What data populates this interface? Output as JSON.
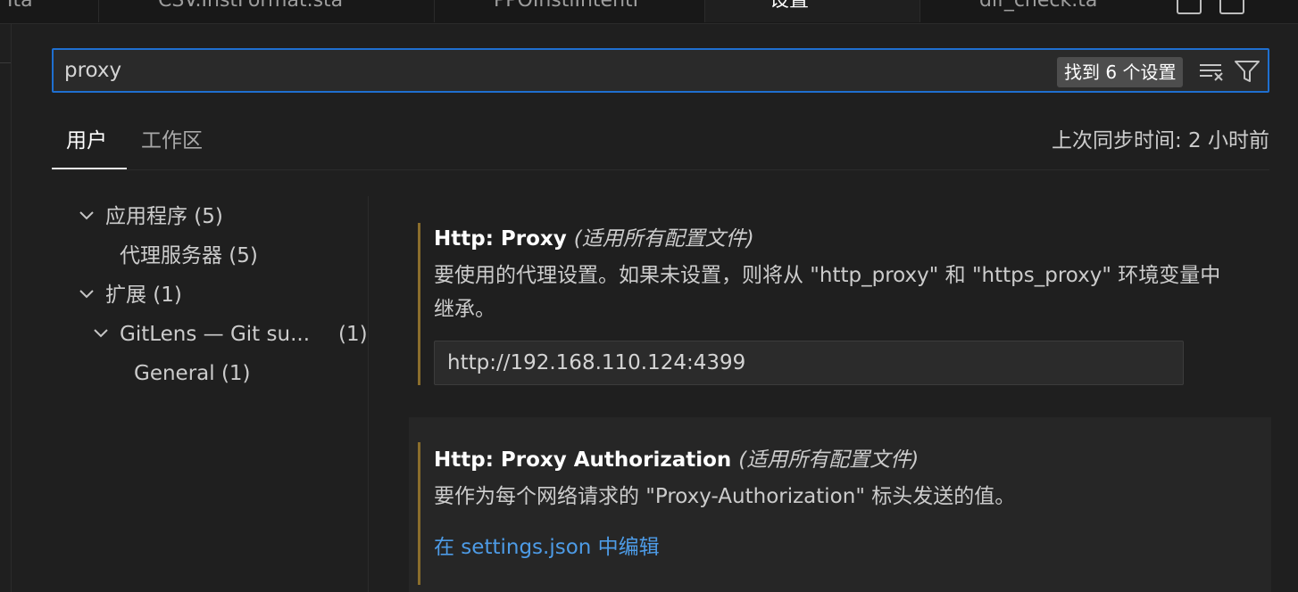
{
  "tabs": [
    {
      "label": "Ita"
    },
    {
      "label": "CSV.InstFormat.sta"
    },
    {
      "label": "PPOInstiIntentI"
    },
    {
      "label": "设置",
      "active": true
    },
    {
      "label": "dif_check.ta"
    }
  ],
  "search": {
    "value": "proxy",
    "placeholder": "",
    "found_label": "找到 6 个设置"
  },
  "scope_tabs": [
    {
      "label": "用户",
      "active": true
    },
    {
      "label": "工作区",
      "active": false
    }
  ],
  "sync_status": "上次同步时间: 2 小时前",
  "toc": [
    {
      "label": "应用程序 (5)",
      "expanded": true
    },
    {
      "label": "代理服务器 (5)"
    },
    {
      "label": "扩展 (1)",
      "expanded": true
    },
    {
      "label": "GitLens — Git su...",
      "count": "(1)",
      "expanded": true
    },
    {
      "label": "General (1)"
    }
  ],
  "settings": [
    {
      "category": "Http: ",
      "name": "Proxy",
      "scope": "(适用所有配置文件)",
      "description": "要使用的代理设置。如果未设置，则将从 \"http_proxy\" 和 \"https_proxy\" 环境变量中继承。",
      "value": "http://192.168.110.124:4399"
    },
    {
      "category": "Http: ",
      "name": "Proxy Authorization",
      "scope": "(适用所有配置文件)",
      "description": "要作为每个网络请求的 \"Proxy-Authorization\" 标头发送的值。",
      "link": "在 settings.json 中编辑"
    }
  ],
  "colors": {
    "accent": "#1f6fd0",
    "modified_bar": "#8a6d2c",
    "link": "#4d9be6"
  },
  "icons": [
    "clear-filter-icon",
    "filter-icon",
    "chevron-down-icon"
  ]
}
